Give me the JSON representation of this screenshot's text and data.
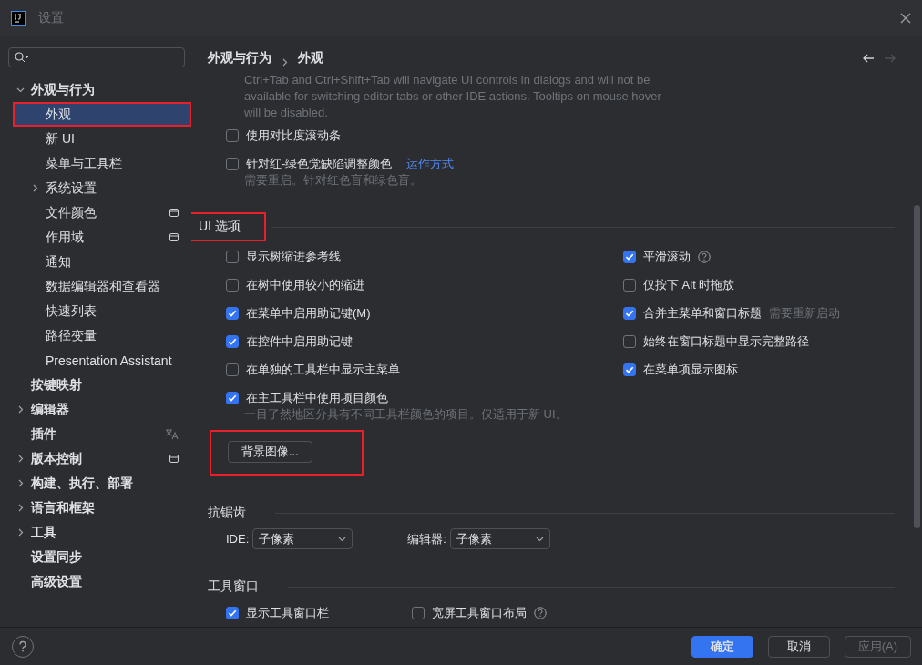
{
  "window": {
    "title": "设置"
  },
  "sidebar": {
    "items": [
      {
        "label": "外观与行为",
        "expanded": true,
        "selected": false,
        "children": [
          {
            "label": "外观",
            "selected": true,
            "highlighted": true
          },
          {
            "label": "新 UI",
            "selected": false
          },
          {
            "label": "菜单与工具栏",
            "selected": false
          },
          {
            "label": "系统设置",
            "selected": false,
            "expanded": false
          },
          {
            "label": "文件颜色",
            "selected": false,
            "badge": {
              "kind": "project"
            }
          },
          {
            "label": "作用域",
            "selected": false,
            "badge": {
              "kind": "project"
            }
          },
          {
            "label": "通知",
            "selected": false
          },
          {
            "label": "数据编辑器和查看器",
            "selected": false
          },
          {
            "label": "快速列表",
            "selected": false
          },
          {
            "label": "路径变量",
            "selected": false
          },
          {
            "label": "Presentation Assistant",
            "selected": false
          }
        ]
      },
      {
        "label": "按键映射",
        "selected": false
      },
      {
        "label": "编辑器",
        "selected": false,
        "expanded": false
      },
      {
        "label": "插件",
        "selected": false,
        "badge": {
          "kind": "translate"
        }
      },
      {
        "label": "版本控制",
        "selected": false,
        "expanded": false,
        "badge": {
          "kind": "project"
        }
      },
      {
        "label": "构建、执行、部署",
        "selected": false,
        "expanded": false
      },
      {
        "label": "语言和框架",
        "selected": false,
        "expanded": false
      },
      {
        "label": "工具",
        "selected": false,
        "expanded": false
      },
      {
        "label": "设置同步",
        "selected": false
      },
      {
        "label": "高级设置",
        "selected": false
      }
    ]
  },
  "breadcrumb": [
    "外观与行为",
    "外观"
  ],
  "nav": [
    {
      "kind": "back",
      "disabled": false
    },
    {
      "kind": "forward",
      "disabled": true
    }
  ],
  "content": [
    {
      "kind": "note",
      "text": "Ctrl+Tab and Ctrl+Shift+Tab will navigate UI controls in dialogs and will not be available for switching editor tabs or other IDE actions. Tooltips on mouse hover will be disabled."
    },
    {
      "kind": "checkbox",
      "label": "使用对比度滚动条",
      "checked": false
    },
    {
      "kind": "checkbox",
      "label": "针对红-绿色觉缺陷调整颜色",
      "checked": false,
      "link": "运作方式",
      "hint": "需要重启。针对红色盲和绿色盲。"
    },
    {
      "kind": "section",
      "title": "UI 选项",
      "highlighted": true
    },
    {
      "kind": "grid",
      "columns": [
        [
          {
            "label": "显示树缩进参考线",
            "checked": false
          },
          {
            "label": "在树中使用较小的缩进",
            "checked": false
          },
          {
            "label": "在菜单中启用助记键(M)",
            "checked": true
          },
          {
            "label": "在控件中启用助记键",
            "checked": true
          },
          {
            "label": "在单独的工具栏中显示主菜单",
            "checked": false
          },
          {
            "label": "在主工具栏中使用项目颜色",
            "checked": true,
            "hint": "一目了然地区分具有不同工具栏颜色的项目。仅适用于新 UI。"
          }
        ],
        [
          {
            "label": "平滑滚动",
            "checked": true,
            "help": true
          },
          {
            "label": "仅按下 Alt 时拖放",
            "checked": false
          },
          {
            "label": "合并主菜单和窗口标题",
            "checked": true,
            "note": "需要重新启动"
          },
          {
            "label": "始终在窗口标题中显示完整路径",
            "checked": false
          },
          {
            "label": "在菜单项显示图标",
            "checked": true
          }
        ]
      ]
    },
    {
      "kind": "button",
      "label": "背景图像...",
      "highlighted": true
    },
    {
      "kind": "section",
      "title": "抗锯齿",
      "highlighted": false
    },
    {
      "kind": "selects",
      "items": [
        {
          "label": "IDE:",
          "value": "子像素"
        },
        {
          "label": "编辑器:",
          "value": "子像素"
        }
      ]
    },
    {
      "kind": "section",
      "title": "工具窗口",
      "highlighted": false
    },
    {
      "kind": "row",
      "items": [
        {
          "label": "显示工具窗口栏",
          "checked": true
        },
        {
          "label": "宽屏工具窗口布局",
          "checked": false,
          "help": true
        }
      ]
    }
  ],
  "buttons": [
    {
      "label": "确定",
      "kind": "primary",
      "disabled": false
    },
    {
      "label": "取消",
      "kind": "normal",
      "disabled": false
    },
    {
      "label": "应用(A)",
      "kind": "normal",
      "disabled": true
    }
  ]
}
